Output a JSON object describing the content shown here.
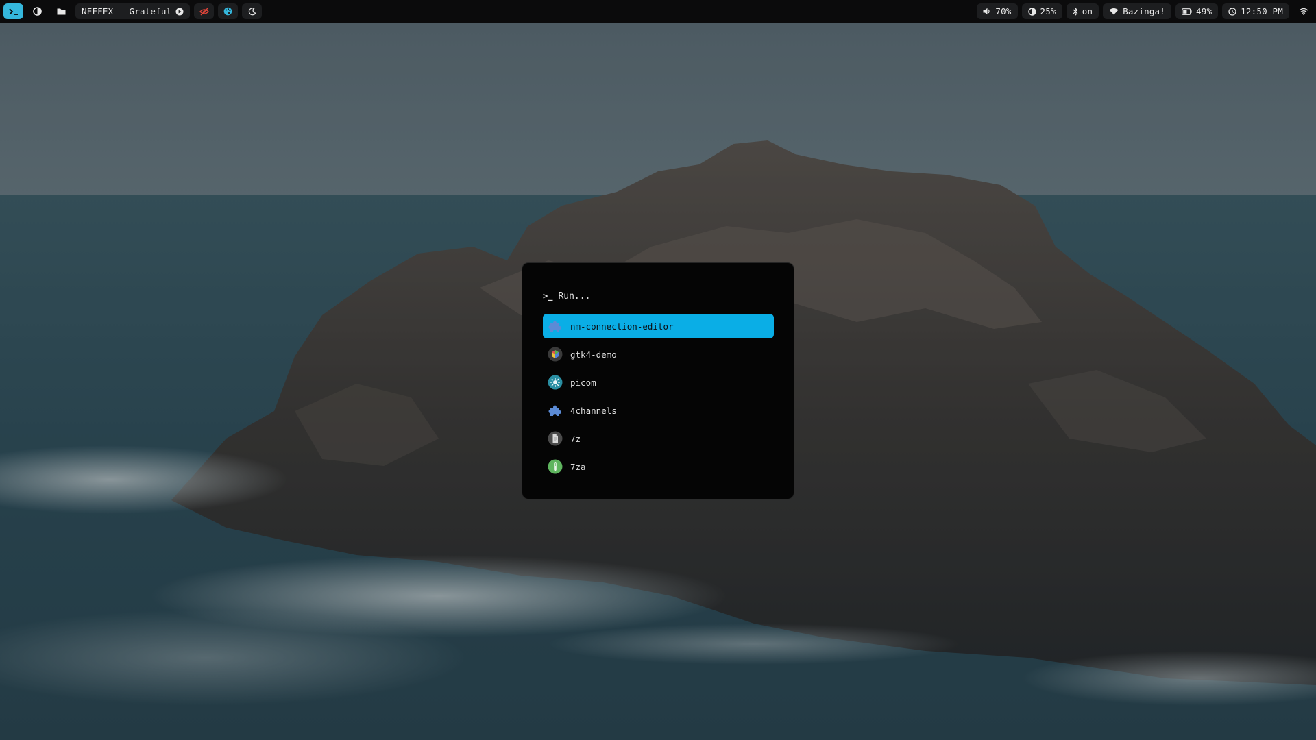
{
  "topbar": {
    "left": {
      "launcher_icon": "terminal-prompt-icon",
      "workspace_icons": [
        "circle-half-icon",
        "folder-icon"
      ],
      "media_title": "NEFFEX - Grateful",
      "media_icon": "play-circle-icon",
      "extra_icons": [
        "eye-off-icon",
        "palette-icon",
        "moon-icon"
      ]
    },
    "right": {
      "volume": "70%",
      "brightness": "25%",
      "bluetooth": "on",
      "wifi": "Bazinga!",
      "battery": "49%",
      "clock": "12:50 PM",
      "tray_icon": "wifi-icon"
    }
  },
  "launcher": {
    "prompt_symbol": ">_",
    "prompt_label": "Run...",
    "results": [
      {
        "label": "nm-connection-editor",
        "icon": "puzzle-icon",
        "selected": true
      },
      {
        "label": "gtk4-demo",
        "icon": "gtk-icon",
        "selected": false
      },
      {
        "label": "picom",
        "icon": "picom-icon",
        "selected": false
      },
      {
        "label": "4channels",
        "icon": "puzzle-icon",
        "selected": false
      },
      {
        "label": "7z",
        "icon": "file-icon",
        "selected": false
      },
      {
        "label": "7za",
        "icon": "archive-icon",
        "selected": false
      }
    ]
  },
  "colors": {
    "accent": "#35b7dc",
    "selected_row": "#0aaee6",
    "bar_bg": "#0b0b0c"
  }
}
